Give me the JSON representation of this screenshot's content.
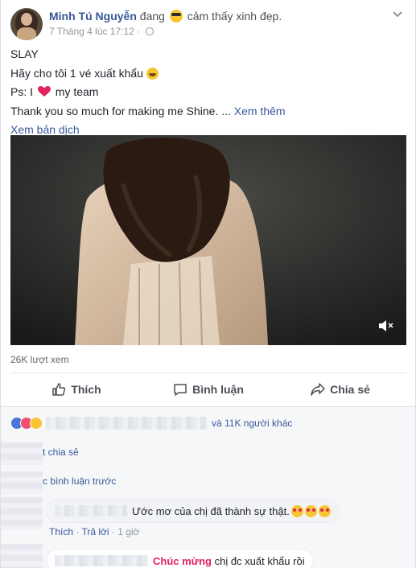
{
  "post": {
    "author": "Minh Tú Nguyễn",
    "feeling_prefix": "đang",
    "feeling_text": "cảm thấy xinh đẹp.",
    "timestamp": "7 Tháng 4 lúc 17:12",
    "separator": "·",
    "lines": {
      "l1": "SLAY",
      "l2": "Hãy cho tôi 1 vé xuất khẩu",
      "l3_before": "Ps: I",
      "l3_after": "my team",
      "l4": "Thank you so much for making me Shine. ...",
      "see_more": "Xem thêm"
    },
    "see_translation": "Xem bản dịch",
    "views": "26K lượt xem"
  },
  "actions": {
    "like": "Thích",
    "comment": "Bình luận",
    "share": "Chia sẻ"
  },
  "reactions": {
    "summary": "và 11K người khác",
    "types": [
      "like-icon",
      "love-icon",
      "haha-icon"
    ]
  },
  "comments_area": {
    "shares_link": "t chia sẻ",
    "previous_comments_link": "c bình luận trước",
    "comment1": {
      "text": "Ước mơ của chị đã thành sự thật.",
      "like": "Thích",
      "reply": "Trả lời",
      "time": "1 giờ",
      "sep": "·"
    },
    "comment2": {
      "highlight": "Chúc mừng",
      "text": "chị đc xuất khẩu rồi"
    }
  },
  "colors": {
    "link": "#365899",
    "heart": "#e0245e",
    "background": "#f6f7f9"
  }
}
